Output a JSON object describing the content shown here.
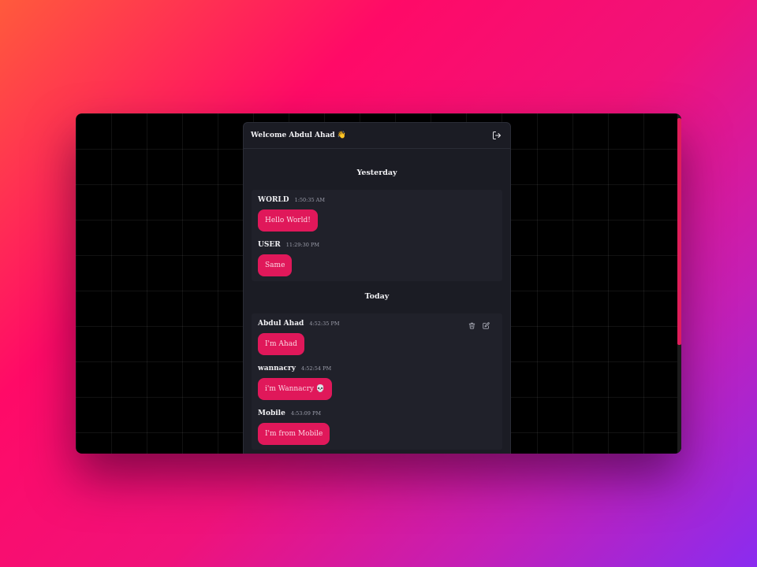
{
  "header": {
    "welcome": "Welcome Abdul Ahad 👋"
  },
  "days": {
    "yesterday": "Yesterday",
    "today": "Today"
  },
  "messages_yesterday": [
    {
      "author": "WORLD",
      "time": "1:50:35 AM",
      "text": "Hello World!"
    },
    {
      "author": "USER",
      "time": "11:29:30 PM",
      "text": "Same"
    }
  ],
  "messages_today": [
    {
      "author": "Abdul Ahad",
      "time": "4:52:35 PM",
      "text": "I'm Ahad"
    },
    {
      "author": "wannacry",
      "time": "4:52:54 PM",
      "text": "i'm Wannacry 💀"
    },
    {
      "author": "Mobile",
      "time": "4:53:09 PM",
      "text": "I'm from Mobile"
    }
  ],
  "icons": {
    "logout": "logout-icon",
    "delete": "trash-icon",
    "edit": "edit-icon"
  },
  "colors": {
    "accent": "#e0185a",
    "panel": "#1b1c24",
    "group": "#20212a"
  }
}
